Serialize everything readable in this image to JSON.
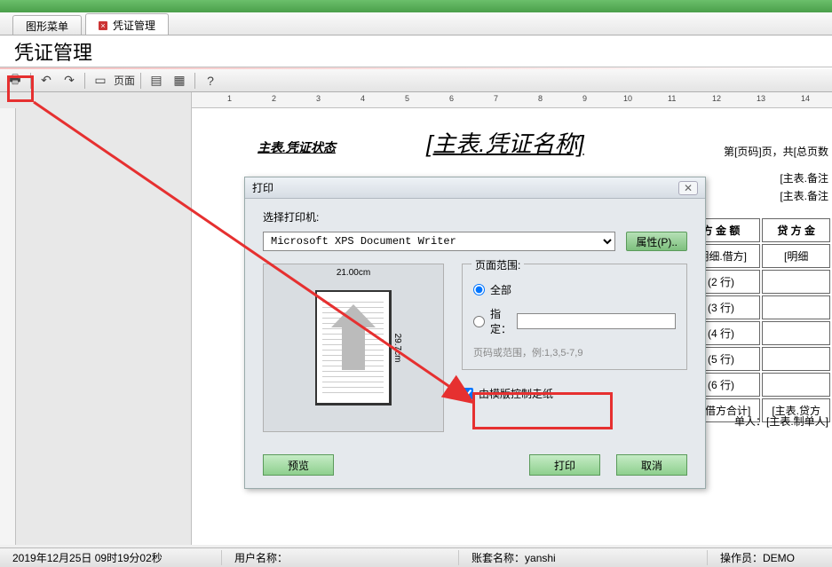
{
  "tabs": {
    "graphic": "图形菜单",
    "voucher": "凭证管理"
  },
  "page_title": "凭证管理",
  "toolbar": {
    "page_label": "页面"
  },
  "report": {
    "state": "主表.凭证状态",
    "title": "[主表.凭证名称]",
    "page_info": "第[页码]页，共[总页数",
    "note1": "[主表.备注",
    "note2": "[主表.备注",
    "col_debit": "方 金 额",
    "col_credit": "贷 方 金",
    "sub_debit": "[明细.借方]",
    "sub_credit": "[明细",
    "rows": [
      "(2 行)",
      "(3 行)",
      "(4 行)",
      "(5 行)",
      "(6 行)"
    ],
    "sum_debit": "表.借方合计]",
    "sum_credit": "[主表.贷方",
    "maker_lbl": "单人：",
    "maker_val": "[主表.制单人]"
  },
  "dialog": {
    "title": "打印",
    "select_label": "选择打印机:",
    "printer": "Microsoft XPS Document Writer",
    "props_btn": "属性(P)..",
    "paper_w": "21.00cm",
    "paper_h": "29.7cm",
    "range_title": "页面范围:",
    "range_all": "全部",
    "range_spec": "指定：",
    "range_hint": "页码或范围，例:1,3,5-7,9",
    "tpl_check": "由模版控制走纸",
    "preview_btn": "预览",
    "print_btn": "打印",
    "cancel_btn": "取消"
  },
  "status": {
    "date": "2019年12月25日   09时19分02秒",
    "user_lbl": "用户名称：",
    "acct_lbl": "账套名称：",
    "acct_val": "yanshi",
    "op_lbl": "操作员：",
    "op_val": "DEMO"
  }
}
